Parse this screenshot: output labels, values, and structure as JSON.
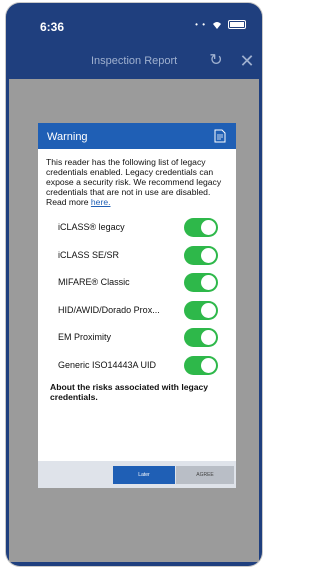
{
  "status_bar": {
    "time": "6:36"
  },
  "nav": {
    "title": "Inspection Report"
  },
  "dialog": {
    "title": "Warning",
    "message": "This reader has the following list of legacy credentials enabled. Legacy credentials can expose a security risk. We recommend legacy credentials that are not in use are disabled. Read more",
    "link": "here.",
    "credentials": [
      {
        "label": "iCLASS® legacy",
        "enabled": true
      },
      {
        "label": "iCLASS SE/SR",
        "enabled": true
      },
      {
        "label": "MIFARE® Classic",
        "enabled": true
      },
      {
        "label": "HID/AWID/Dorado Prox...",
        "enabled": true
      },
      {
        "label": "EM Proximity",
        "enabled": true
      },
      {
        "label": "Generic ISO14443A UID",
        "enabled": true
      }
    ],
    "risks_link": "About the risks associated with legacy credentials.",
    "buttons": {
      "later": "Later",
      "agree": "AGREE"
    }
  },
  "colors": {
    "nav": "#1f3f7e",
    "accent": "#1f5fb5",
    "toggle_on": "#2eb84a"
  }
}
